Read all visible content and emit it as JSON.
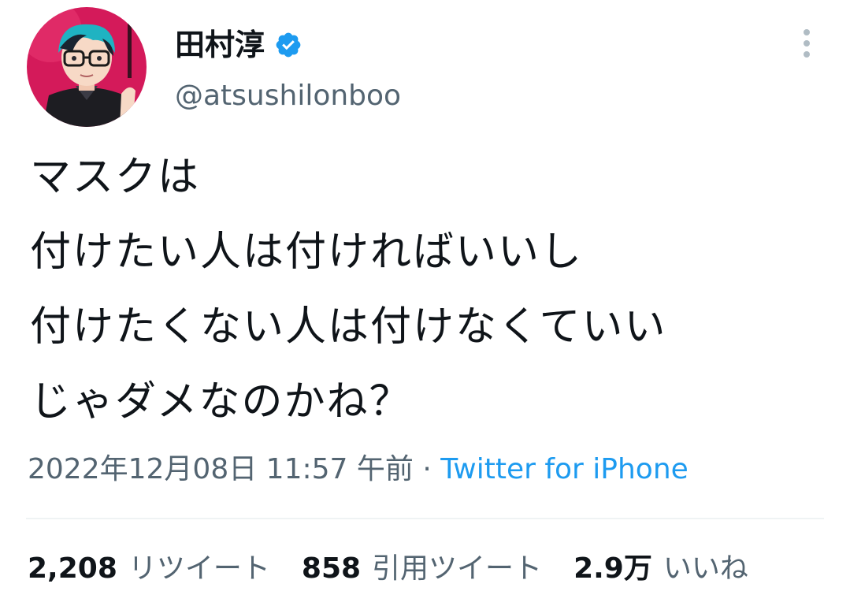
{
  "author": {
    "display_name": "田村淳",
    "handle": "@atsushilonboo",
    "verified": true,
    "avatar": "illustrated-avatar-teal-hair-glasses-pink-background"
  },
  "tweet": {
    "lines": [
      "マスクは",
      "付けたい人は付ければいいし",
      "付けたくない人は付けなくていい",
      "じゃダメなのかね？"
    ]
  },
  "meta": {
    "timestamp": "2022年12月08日 11:57 午前",
    "separator": "·",
    "source": "Twitter for iPhone"
  },
  "stats": {
    "retweets": {
      "count": "2,208",
      "label": "リツイート"
    },
    "quotes": {
      "count": "858",
      "label": "引用ツイート"
    },
    "likes": {
      "count": "2.9万",
      "label": "いいね"
    }
  },
  "icons": {
    "more": "more-vertical-icon",
    "verified": "verified-badge-icon"
  },
  "colors": {
    "text_primary": "#0f1419",
    "text_secondary": "#536471",
    "accent": "#1d9bf0",
    "divider": "#eff3f4",
    "more_dots": "#b0bcc4",
    "avatar_bg": "#d41a5a"
  }
}
